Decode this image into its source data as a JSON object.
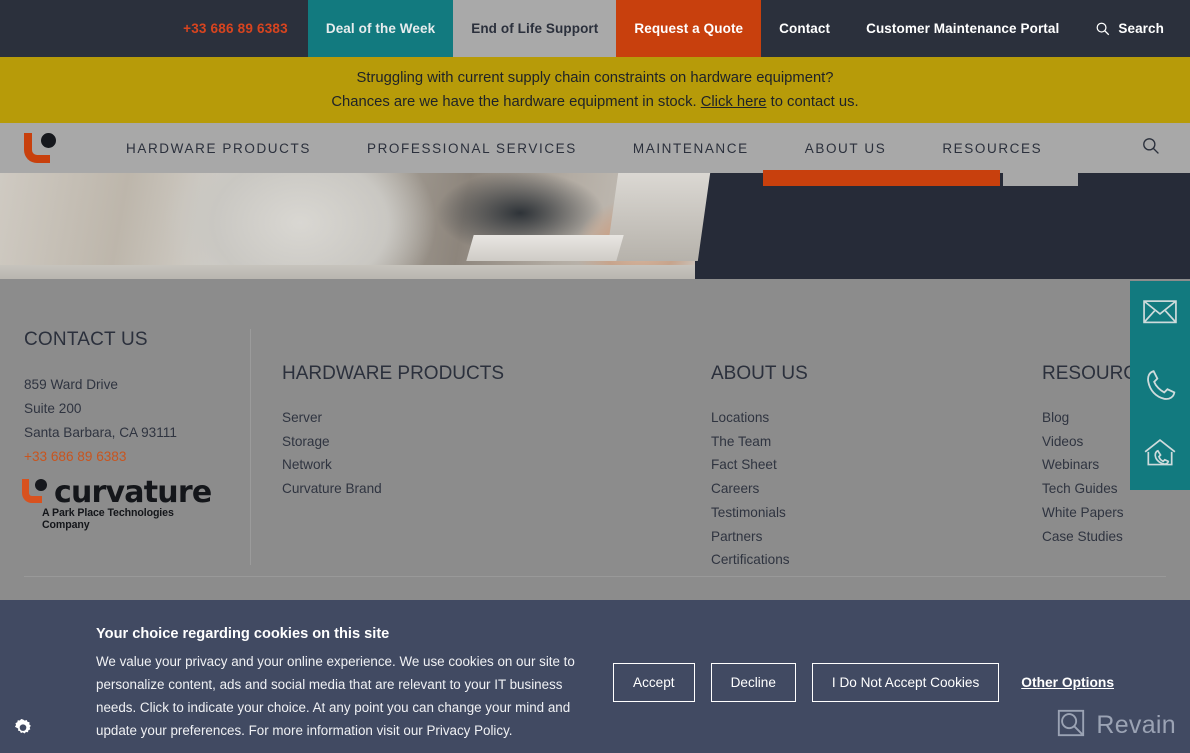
{
  "topbar": {
    "phone": "+33 686 89 6383",
    "items": [
      {
        "label": "Deal of the Week",
        "style": "deal"
      },
      {
        "label": "End of Life Support",
        "style": "eol"
      },
      {
        "label": "Request a Quote",
        "style": "quote"
      },
      {
        "label": "Contact",
        "style": "plain"
      },
      {
        "label": "Customer Maintenance Portal",
        "style": "plain"
      }
    ],
    "search_label": "Search",
    "search_icon": "search-icon",
    "colors": {
      "bar_bg": "#2b303c",
      "phone": "#d8441f",
      "deal_bg": "#127a7f",
      "eol_bg": "#a9a9a9",
      "quote_bg": "#c8400d"
    }
  },
  "promo": {
    "line1": "Struggling with current supply chain constraints on hardware equipment?",
    "line2_before": "Chances are we have the hardware equipment in stock. ",
    "line2_link": "Click here",
    "line2_after": " to contact us.",
    "bg": "#b79b09"
  },
  "mainnav": {
    "logo_name": "curvature-logo",
    "links": [
      "HARDWARE PRODUCTS",
      "PROFESSIONAL SERVICES",
      "MAINTENANCE",
      "ABOUT US",
      "RESOURCES"
    ],
    "search_icon": "search-icon",
    "bg": "#a8a8a8"
  },
  "hero": {
    "photo_alt": "person typing on keyboard at desk",
    "bg": "#262b38"
  },
  "footer": {
    "contact": {
      "heading": "CONTACT US",
      "address_lines": [
        "859 Ward Drive",
        "Suite 200",
        "Santa Barbara, CA 93111"
      ],
      "phone": "+33 686 89 6383",
      "logo_word": "curvature",
      "logo_tagline": "A Park Place Technologies Company"
    },
    "columns": [
      {
        "heading": "HARDWARE PRODUCTS",
        "links": [
          "Server",
          "Storage",
          "Network",
          "Curvature Brand"
        ]
      },
      {
        "heading": "ABOUT US",
        "links": [
          "Locations",
          "The Team",
          "Fact Sheet",
          "Careers",
          "Testimonials",
          "Partners",
          "Certifications"
        ]
      },
      {
        "heading": "RESOURCES",
        "links": [
          "Blog",
          "Videos",
          "Webinars",
          "Tech Guides",
          "White Papers",
          "Case Studies"
        ]
      }
    ],
    "bg": "#8c8c8c"
  },
  "side_widget": {
    "bg": "#127a7f",
    "icons": [
      "email-icon",
      "phone-icon",
      "home-service-icon"
    ]
  },
  "cookie": {
    "title": "Your choice regarding cookies on this site",
    "body": "We value your privacy and your online experience. We use cookies on our site to personalize content, ads and social media that are relevant to your IT business needs. Click to indicate your choice. At any point you can change your mind and update your preferences. For more information visit our Privacy Policy.",
    "buttons": [
      "Accept",
      "Decline",
      "I Do Not Accept Cookies"
    ],
    "other_options": "Other Options",
    "settings_icon": "gear-icon",
    "bg": "#414a62"
  },
  "watermark": {
    "label": "Revain",
    "icon": "revain-logo-icon"
  }
}
